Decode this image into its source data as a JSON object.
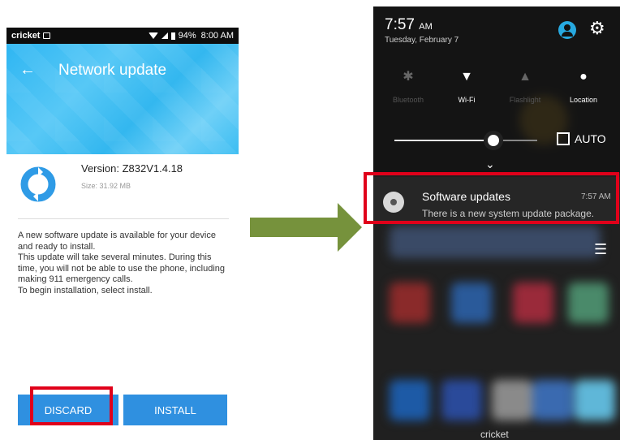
{
  "left_screen": {
    "status_bar": {
      "carrier": "cricket",
      "battery": "94%",
      "time": "8:00 AM"
    },
    "header": {
      "title": "Network update"
    },
    "update": {
      "version": "Version: Z832V1.4.18",
      "size": "Size: 31.92 MB",
      "description": "A new software update is available for your device and ready to install.\nThis update will take several minutes. During this time, you will not be able to use the phone, including making 911 emergency calls.\nTo begin installation, select install."
    },
    "buttons": {
      "discard": "DISCARD",
      "install": "INSTALL"
    },
    "colors": {
      "header": "#33b7ef",
      "button": "#2f90e0",
      "highlight": "#e0001a"
    }
  },
  "arrow": {
    "color": "#76923c"
  },
  "right_screen": {
    "header": {
      "time": "7:57",
      "ampm": "AM",
      "date": "Tuesday, February 7"
    },
    "quick_settings": [
      {
        "label": "Bluetooth",
        "icon": "bluetooth-off-icon",
        "active": false
      },
      {
        "label": "Wi-Fi",
        "icon": "wifi-icon",
        "active": true
      },
      {
        "label": "Flashlight",
        "icon": "flashlight-off-icon",
        "active": false
      },
      {
        "label": "Location",
        "icon": "location-icon",
        "active": true
      }
    ],
    "brightness": {
      "auto_label": "AUTO",
      "level": 0.68
    },
    "notification": {
      "title": "Software updates",
      "time": "7:57 AM",
      "body": "There is a new system update package."
    },
    "dock_label": "cricket"
  }
}
